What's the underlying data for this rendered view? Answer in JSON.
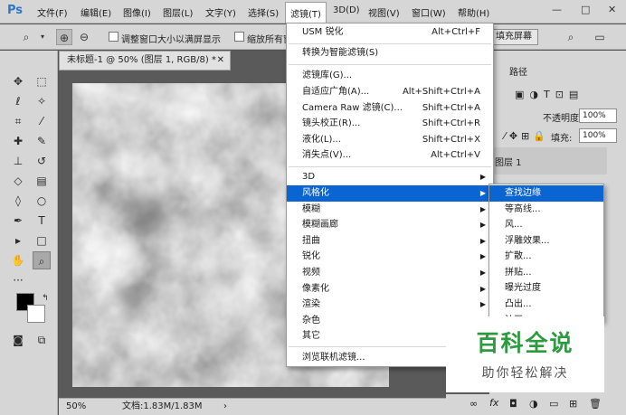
{
  "app": {
    "logo": "Ps"
  },
  "menubar": {
    "items": [
      "文件(F)",
      "编辑(E)",
      "图像(I)",
      "图层(L)",
      "文字(Y)",
      "选择(S)",
      "滤镜(T)",
      "3D(D)",
      "视图(V)",
      "窗口(W)",
      "帮助(H)"
    ],
    "window_buttons": [
      "—",
      "□",
      "✕"
    ]
  },
  "options": {
    "resize_label": "调整窗口大小以满屏显示",
    "zoom_all_label": "缩放所有窗口",
    "fill_screen": "填充屏幕"
  },
  "document": {
    "tab_title": "未标题-1 @ 50% (图层 1, RGB/8) *",
    "zoom": "50%",
    "doc_info": "文档:1.83M/1.83M"
  },
  "panels": {
    "path_tab": "路径",
    "opacity_label": "不透明度:",
    "opacity_value": "100%",
    "fill_label": "填充:",
    "fill_value": "100%",
    "layer_name": "图层 1"
  },
  "filter_menu": [
    {
      "label": "USM 锐化",
      "shortcut": "Alt+Ctrl+F"
    },
    {
      "label": "转换为智能滤镜(S)",
      "shortcut": ""
    },
    {
      "label": "滤镜库(G)...",
      "shortcut": ""
    },
    {
      "label": "自适应广角(A)...",
      "shortcut": "Alt+Shift+Ctrl+A"
    },
    {
      "label": "Camera Raw 滤镜(C)...",
      "shortcut": "Shift+Ctrl+A"
    },
    {
      "label": "镜头校正(R)...",
      "shortcut": "Shift+Ctrl+R"
    },
    {
      "label": "液化(L)...",
      "shortcut": "Shift+Ctrl+X"
    },
    {
      "label": "消失点(V)...",
      "shortcut": "Alt+Ctrl+V"
    },
    {
      "label": "3D",
      "shortcut": ""
    },
    {
      "label": "风格化",
      "shortcut": ""
    },
    {
      "label": "模糊",
      "shortcut": ""
    },
    {
      "label": "模糊画廊",
      "shortcut": ""
    },
    {
      "label": "扭曲",
      "shortcut": ""
    },
    {
      "label": "锐化",
      "shortcut": ""
    },
    {
      "label": "视频",
      "shortcut": ""
    },
    {
      "label": "像素化",
      "shortcut": ""
    },
    {
      "label": "渲染",
      "shortcut": ""
    },
    {
      "label": "杂色",
      "shortcut": ""
    },
    {
      "label": "其它",
      "shortcut": ""
    },
    {
      "label": "浏览联机滤镜...",
      "shortcut": ""
    }
  ],
  "stylize_submenu": [
    "查找边缘",
    "等高线...",
    "风...",
    "浮雕效果...",
    "扩散...",
    "拼贴...",
    "曝光过度",
    "凸出...",
    "油画..."
  ],
  "watermark": {
    "title": "百科全说",
    "subtitle": "助你轻松解决"
  },
  "colors": {
    "highlight": "#0a64d2",
    "watermark_green": "#2c9a3e"
  }
}
